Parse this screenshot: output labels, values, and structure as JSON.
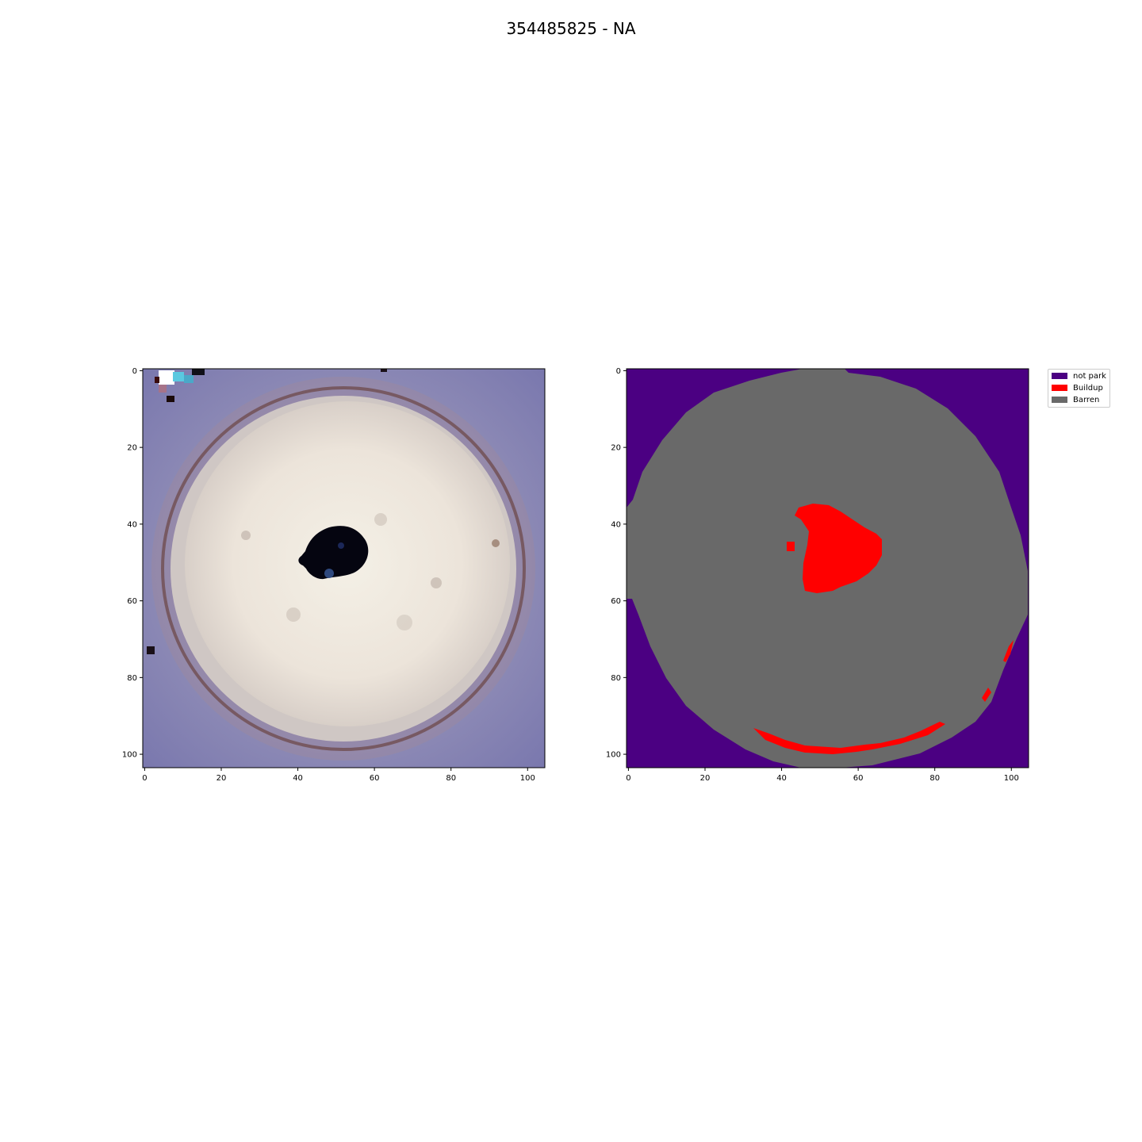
{
  "title": "354485825 - NA",
  "chart_data": [
    {
      "type": "heatmap",
      "subtype": "rgb-image",
      "description_of_content": "false-color satellite image",
      "x_ticks": [
        0,
        20,
        40,
        60,
        80,
        100
      ],
      "y_ticks": [
        0,
        20,
        40,
        60,
        80,
        100
      ],
      "xlim": [
        -0.5,
        104.5
      ],
      "ylim": [
        103.5,
        -0.5
      ],
      "grid": false
    },
    {
      "type": "heatmap",
      "subtype": "classification-map",
      "x_ticks": [
        0,
        20,
        40,
        60,
        80,
        100
      ],
      "y_ticks": [
        0,
        20,
        40,
        60,
        80,
        100
      ],
      "xlim": [
        -0.5,
        104.5
      ],
      "ylim": [
        103.5,
        -0.5
      ],
      "grid": false,
      "legend_position": "outside-top-right",
      "classes": [
        {
          "name": "not park",
          "color": "#4b0082"
        },
        {
          "name": "Buildup",
          "color": "#ff0000"
        },
        {
          "name": "Barren",
          "color": "#696969"
        }
      ]
    }
  ]
}
